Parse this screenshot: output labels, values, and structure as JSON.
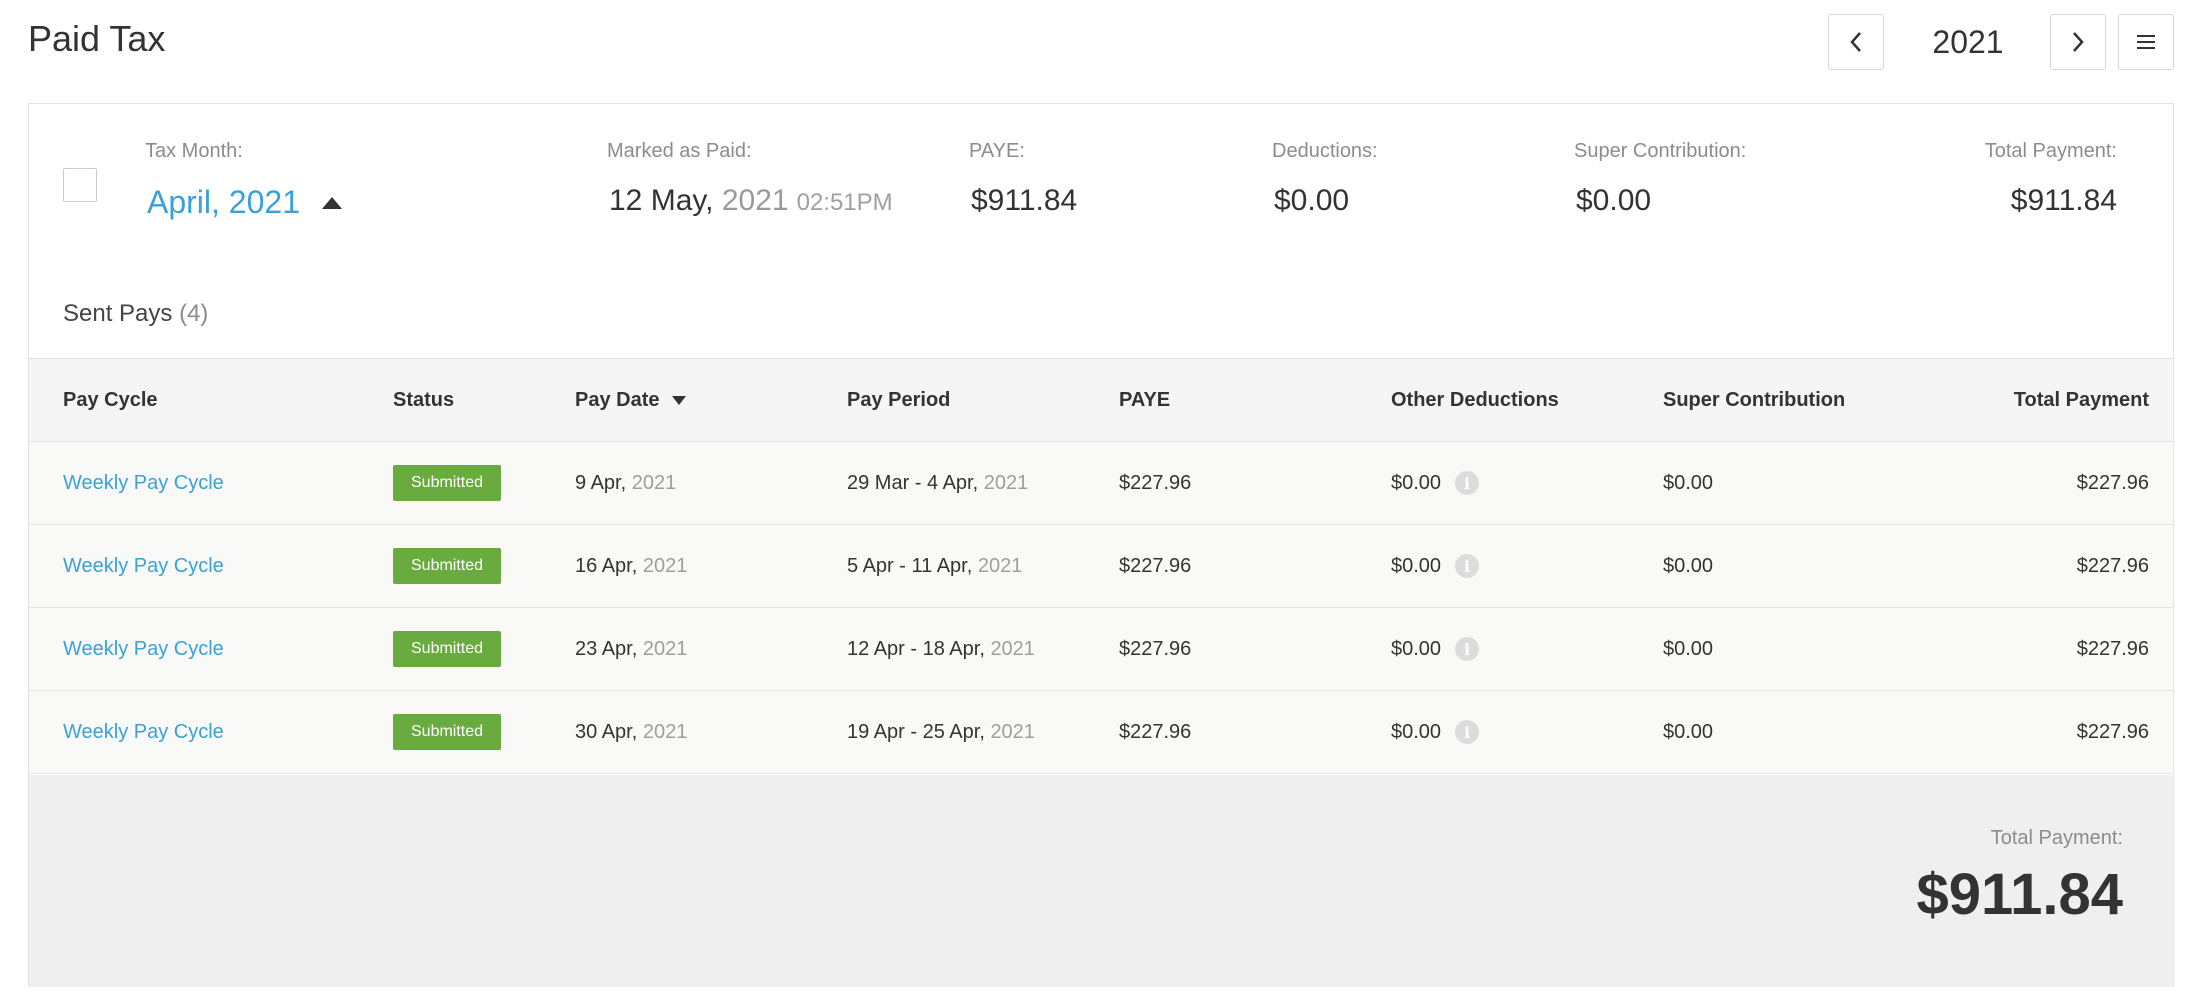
{
  "header": {
    "title": "Paid Tax",
    "year": "2021",
    "prev_icon": "chevron-left-icon",
    "next_icon": "chevron-right-icon",
    "menu_icon": "hamburger-menu-icon"
  },
  "summary": {
    "tax_month_label": "Tax Month:",
    "tax_month_value": "April, 2021",
    "marked_paid_label": "Marked as Paid:",
    "marked_paid_date": "12 May,",
    "marked_paid_year": "2021",
    "marked_paid_time": "02:51PM",
    "paye_label": "PAYE:",
    "paye_value": "$911.84",
    "deductions_label": "Deductions:",
    "deductions_value": "$0.00",
    "super_label": "Super Contribution:",
    "super_value": "$0.00",
    "total_label": "Total Payment:",
    "total_value": "$911.84"
  },
  "sent_pays": {
    "title": "Sent Pays",
    "count": "(4)"
  },
  "table": {
    "columns": [
      "Pay Cycle",
      "Status",
      "Pay Date",
      "Pay Period",
      "PAYE",
      "Other Deductions",
      "Super Contribution",
      "Total Payment"
    ],
    "rows": [
      {
        "cycle": "Weekly Pay Cycle",
        "status": "Submitted",
        "pay_date": "9 Apr,",
        "pay_date_year": "2021",
        "period": "29 Mar - 4 Apr,",
        "period_year": "2021",
        "paye": "$227.96",
        "other": "$0.00",
        "super": "$0.00",
        "total": "$227.96"
      },
      {
        "cycle": "Weekly Pay Cycle",
        "status": "Submitted",
        "pay_date": "16 Apr,",
        "pay_date_year": "2021",
        "period": "5 Apr - 11 Apr,",
        "period_year": "2021",
        "paye": "$227.96",
        "other": "$0.00",
        "super": "$0.00",
        "total": "$227.96"
      },
      {
        "cycle": "Weekly Pay Cycle",
        "status": "Submitted",
        "pay_date": "23 Apr,",
        "pay_date_year": "2021",
        "period": "12 Apr - 18 Apr,",
        "period_year": "2021",
        "paye": "$227.96",
        "other": "$0.00",
        "super": "$0.00",
        "total": "$227.96"
      },
      {
        "cycle": "Weekly Pay Cycle",
        "status": "Submitted",
        "pay_date": "30 Apr,",
        "pay_date_year": "2021",
        "period": "19 Apr - 25 Apr,",
        "period_year": "2021",
        "paye": "$227.96",
        "other": "$0.00",
        "super": "$0.00",
        "total": "$227.96"
      }
    ]
  },
  "footer": {
    "total_label": "Total Payment:",
    "total_value": "$911.84"
  },
  "colors": {
    "link": "#3aa0d8",
    "badge": "#6aab3f",
    "header_bg": "#f5f5f5",
    "footer_bg": "#efefef"
  }
}
